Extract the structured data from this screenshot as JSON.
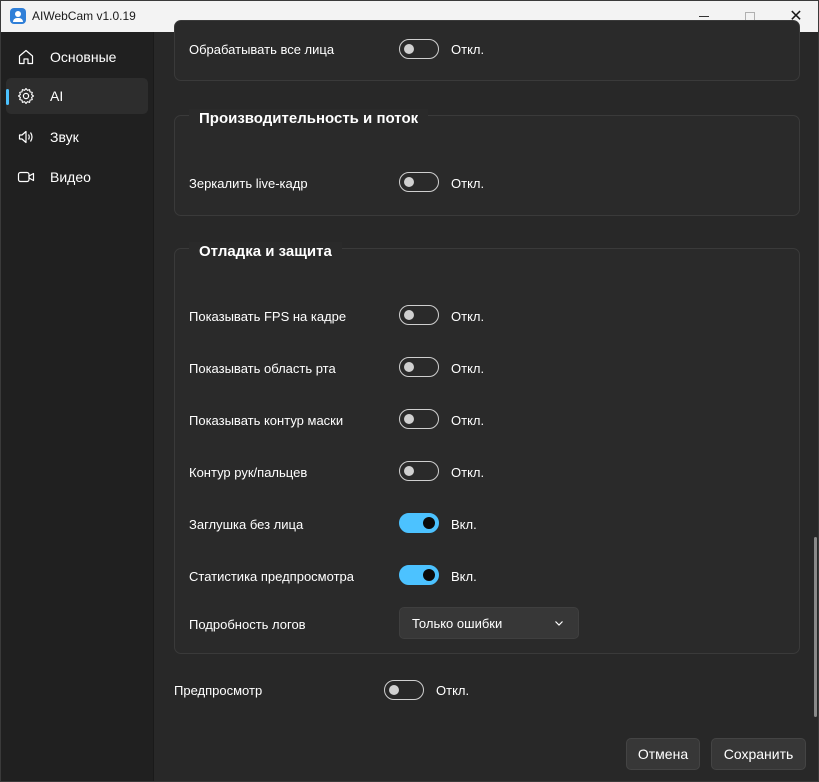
{
  "window": {
    "title": "AIWebCam v1.0.19"
  },
  "sidebar": {
    "items": [
      {
        "label": "Основные",
        "icon": "home-icon"
      },
      {
        "label": "AI",
        "icon": "gear-icon",
        "active": true
      },
      {
        "label": "Звук",
        "icon": "speaker-icon"
      },
      {
        "label": "Видео",
        "icon": "video-camera-icon"
      }
    ]
  },
  "sections": {
    "faces": {
      "rows": [
        {
          "label": "Обрабатывать все лица",
          "on": false,
          "state": "Откл."
        }
      ]
    },
    "performance": {
      "title": "Производительность и поток",
      "rows": [
        {
          "label": "Зеркалить live-кадр",
          "on": false,
          "state": "Откл."
        }
      ]
    },
    "debug": {
      "title": "Отладка и защита",
      "rows": [
        {
          "label": "Показывать FPS на кадре",
          "on": false,
          "state": "Откл."
        },
        {
          "label": "Показывать область рта",
          "on": false,
          "state": "Откл."
        },
        {
          "label": "Показывать контур маски",
          "on": false,
          "state": "Откл."
        },
        {
          "label": "Контур рук/пальцев",
          "on": false,
          "state": "Откл."
        },
        {
          "label": "Заглушка без лица",
          "on": true,
          "state": "Вкл."
        },
        {
          "label": "Статистика предпросмотра",
          "on": true,
          "state": "Вкл."
        }
      ],
      "log_level": {
        "label": "Подробность логов",
        "value": "Только ошибки"
      }
    }
  },
  "preview": {
    "label": "Предпросмотр",
    "on": false,
    "state": "Откл."
  },
  "footer": {
    "cancel_label": "Отмена",
    "save_label": "Сохранить"
  },
  "colors": {
    "accent": "#4cc2ff",
    "background": "#282828",
    "card": "#2a2a2a"
  }
}
